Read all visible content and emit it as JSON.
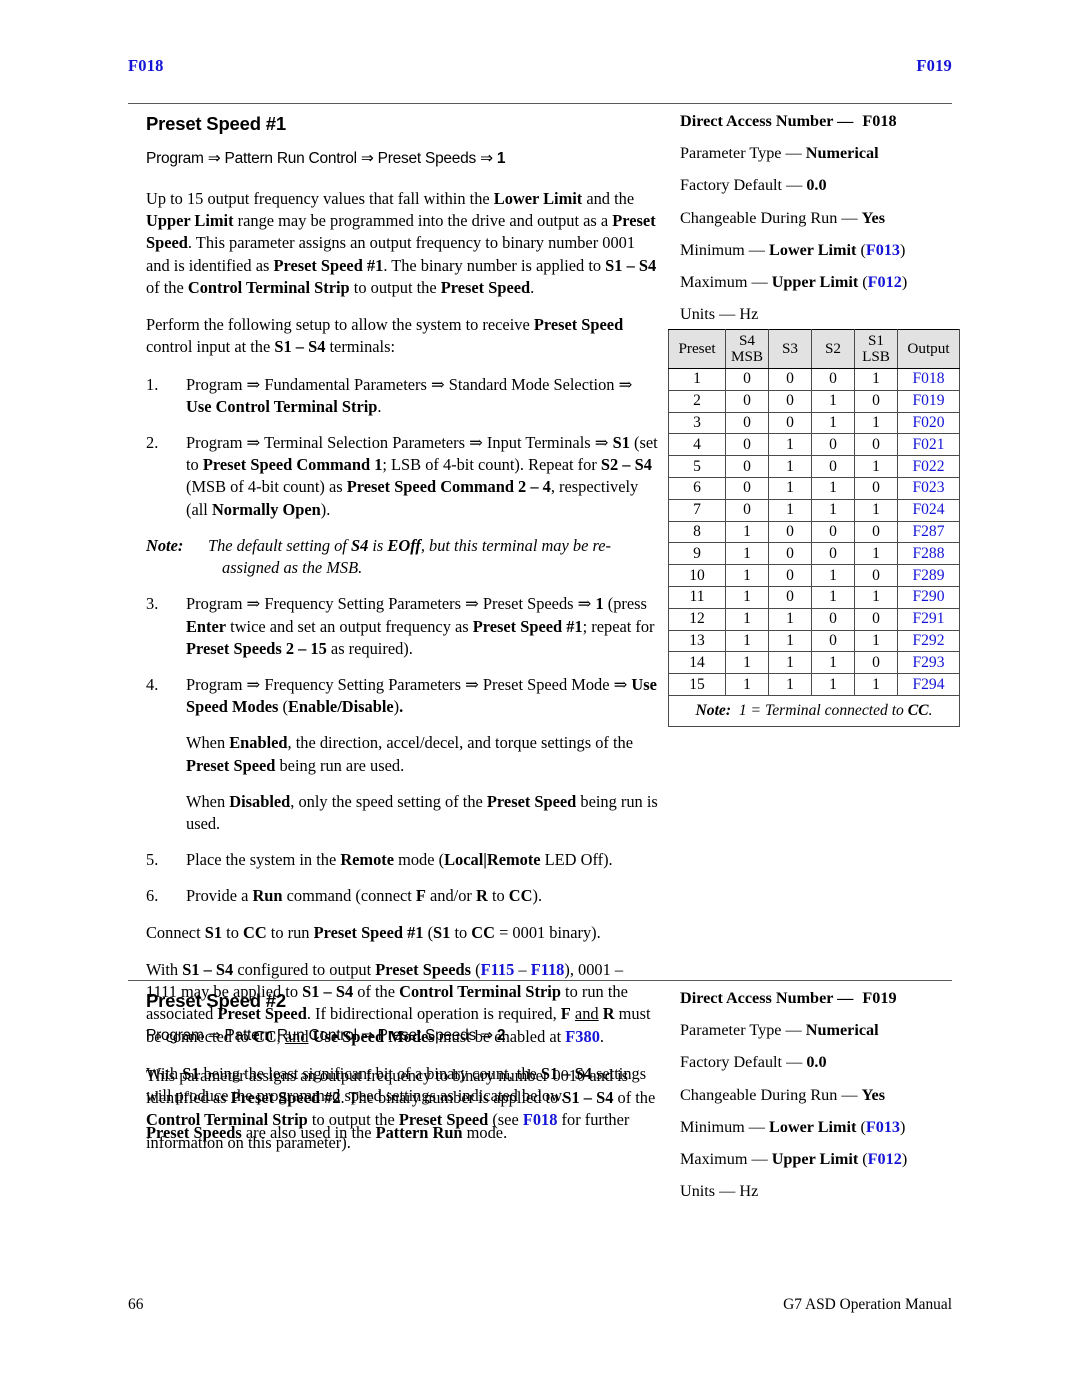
{
  "running_head": {
    "left": "F018",
    "right": "F019"
  },
  "colors": {
    "reference_blue": "#1414d6",
    "rule_gray": "#5a5a5a",
    "table_header_bg": "#e2e2e2"
  },
  "section_1": {
    "title": "Preset Speed #1",
    "path_prefix": "Program ⇒ Pattern Run Control ⇒ Preset Speeds ⇒ ",
    "path_value": "1",
    "paragraph_1": "Up to 15 output frequency values that fall within the Lower Limit and the Upper Limit range may be programmed into the drive and output as a Preset Speed. This parameter assigns an output frequency to binary number 0001 and is identified as Preset Speed #1. The binary number is applied to S1 – S4 of the Control Terminal Strip to output the Preset Speed.",
    "paragraph_2": "Perform the following setup to allow the system to receive Preset Speed control input at the S1 – S4 terminals:",
    "steps": [
      {
        "num": "1.",
        "text": "Program ⇒ Fundamental Parameters ⇒ Standard Mode Selection ⇒ Use Control Terminal Strip."
      },
      {
        "num": "2.",
        "text": "Program ⇒ Terminal Selection Parameters ⇒ Input Terminals ⇒ S1 (set to Preset Speed Command 1; LSB of 4-bit count). Repeat for S2 – S4 (MSB of 4-bit count) as Preset Speed Command 2 – 4, respectively (all Normally Open)."
      },
      {
        "num": "3.",
        "text": "Program ⇒ Frequency Setting Parameters ⇒ Preset Speeds ⇒ 1 (press Enter twice and set an output frequency as Preset Speed #1; repeat for Preset Speeds 2 – 15 as required)."
      },
      {
        "num": "4.",
        "text": "Program ⇒ Frequency Setting Parameters ⇒ Preset Speed Mode ⇒ Use Speed Modes (Enable/Disable)."
      },
      {
        "num": "5.",
        "text": "Place the system in the Remote mode (Local|Remote LED Off)."
      },
      {
        "num": "6.",
        "text": "Provide a Run command (connect F and/or R to CC)."
      }
    ],
    "inline_note": {
      "label": "Note:",
      "line_1": "The default setting of S4 is EOff, but this terminal may be re-",
      "line_2": "assigned as the MSB."
    },
    "sub_paragraphs": [
      "When Enabled, the direction, accel/decel, and torque settings of the Preset Speed being run are used.",
      "When Disabled, only the speed setting of the Preset Speed being run is used."
    ],
    "closing_paragraphs": [
      "Connect S1 to CC to run Preset Speed #1 (S1 to CC = 0001 binary).",
      "With S1 – S4 configured to output Preset Speeds (F115 – F118), 0001 – 1111 may be applied to S1 – S4 of the Control Terminal Strip to run the associated Preset Speed. If bidirectional operation is required, F and R must be connected to CC, and Use Speed Modes must be enabled at F380.",
      "With S1 being the least significant bit of a binary count, the S1 – S4 settings will produce the programmed speed settings as indicated below.",
      "Preset Speeds are also used in the Pattern Run mode."
    ],
    "specs": [
      {
        "label": "Direct Access Number —",
        "value": "F018"
      },
      {
        "label": "Parameter Type —",
        "value": "Numerical"
      },
      {
        "label": "Factory Default —",
        "value": "0.0"
      },
      {
        "label": "Changeable During Run —",
        "value": "Yes"
      },
      {
        "label": "Minimum —",
        "value": "Lower Limit",
        "ref": "F013"
      },
      {
        "label": "Maximum —",
        "value": "Upper Limit",
        "ref": "F012"
      },
      {
        "label": "Units —",
        "value": "Hz"
      }
    ]
  },
  "section_2": {
    "title": "Preset Speed #2",
    "path_prefix": "Program ⇒ Pattern Run Control ⇒ Preset Speeds ⇒ ",
    "path_value": "2",
    "paragraph_1": "This parameter assigns an output frequency to binary number 0010 and is identified as Preset Speed #2. The binary number is applied to S1 – S4 of the Control Terminal Strip to output the Preset Speed (see F018 for further information on this parameter).",
    "specs": [
      {
        "label": "Direct Access Number —",
        "value": "F019"
      },
      {
        "label": "Parameter Type —",
        "value": "Numerical"
      },
      {
        "label": "Factory Default —",
        "value": "0.0"
      },
      {
        "label": "Changeable During Run —",
        "value": "Yes"
      },
      {
        "label": "Minimum —",
        "value": "Lower Limit",
        "ref": "F013"
      },
      {
        "label": "Maximum —",
        "value": "Upper Limit",
        "ref": "F012"
      },
      {
        "label": "Units —",
        "value": "Hz"
      }
    ]
  },
  "truth_table": {
    "headers": [
      {
        "main": "Preset",
        "sub": ""
      },
      {
        "main": "S4",
        "sub": "MSB"
      },
      {
        "main": "S3",
        "sub": ""
      },
      {
        "main": "S2",
        "sub": ""
      },
      {
        "main": "S1",
        "sub": "LSB"
      },
      {
        "main": "Output",
        "sub": ""
      }
    ],
    "rows": [
      {
        "preset": "1",
        "s4": "0",
        "s3": "0",
        "s2": "0",
        "s1": "1",
        "output": "F018"
      },
      {
        "preset": "2",
        "s4": "0",
        "s3": "0",
        "s2": "1",
        "s1": "0",
        "output": "F019"
      },
      {
        "preset": "3",
        "s4": "0",
        "s3": "0",
        "s2": "1",
        "s1": "1",
        "output": "F020"
      },
      {
        "preset": "4",
        "s4": "0",
        "s3": "1",
        "s2": "0",
        "s1": "0",
        "output": "F021"
      },
      {
        "preset": "5",
        "s4": "0",
        "s3": "1",
        "s2": "0",
        "s1": "1",
        "output": "F022"
      },
      {
        "preset": "6",
        "s4": "0",
        "s3": "1",
        "s2": "1",
        "s1": "0",
        "output": "F023"
      },
      {
        "preset": "7",
        "s4": "0",
        "s3": "1",
        "s2": "1",
        "s1": "1",
        "output": "F024"
      },
      {
        "preset": "8",
        "s4": "1",
        "s3": "0",
        "s2": "0",
        "s1": "0",
        "output": "F287"
      },
      {
        "preset": "9",
        "s4": "1",
        "s3": "0",
        "s2": "0",
        "s1": "1",
        "output": "F288"
      },
      {
        "preset": "10",
        "s4": "1",
        "s3": "0",
        "s2": "1",
        "s1": "0",
        "output": "F289"
      },
      {
        "preset": "11",
        "s4": "1",
        "s3": "0",
        "s2": "1",
        "s1": "1",
        "output": "F290"
      },
      {
        "preset": "12",
        "s4": "1",
        "s3": "1",
        "s2": "0",
        "s1": "0",
        "output": "F291"
      },
      {
        "preset": "13",
        "s4": "1",
        "s3": "1",
        "s2": "0",
        "s1": "1",
        "output": "F292"
      },
      {
        "preset": "14",
        "s4": "1",
        "s3": "1",
        "s2": "1",
        "s1": "0",
        "output": "F293"
      },
      {
        "preset": "15",
        "s4": "1",
        "s3": "1",
        "s2": "1",
        "s1": "1",
        "output": "F294"
      }
    ],
    "footnote_label": "Note:",
    "footnote_text": "1 = Terminal connected to CC."
  },
  "footer": {
    "page_number": "66",
    "manual_title": "G7 ASD Operation Manual"
  }
}
